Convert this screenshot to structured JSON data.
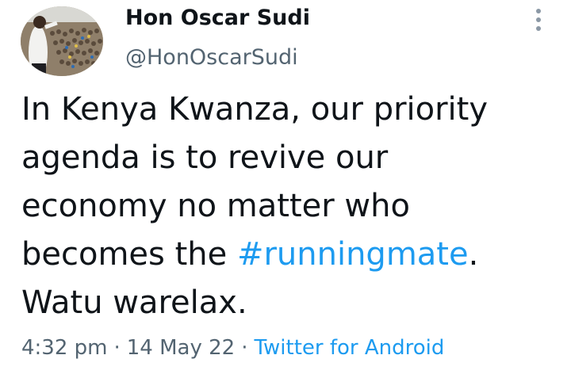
{
  "tweet": {
    "author": {
      "display_name": "Hon Oscar Sudi",
      "handle": "@HonOscarSudi"
    },
    "text": {
      "line1": "In Kenya Kwanza, our priority",
      "line2": "agenda is to revive our",
      "line3": "economy no matter who",
      "line4_prefix": "becomes the ",
      "hashtag": "#runningmate",
      "line4_suffix": ".",
      "line5": "Watu warelax."
    },
    "meta": {
      "time": "4:32 pm",
      "date": "14 May 22",
      "separator": "·",
      "source": "Twitter for Android"
    },
    "icons": {
      "more": "more-vertical-icon"
    }
  },
  "colors": {
    "text_primary": "#0f1419",
    "text_secondary": "#536471",
    "link": "#1d9bf0"
  }
}
